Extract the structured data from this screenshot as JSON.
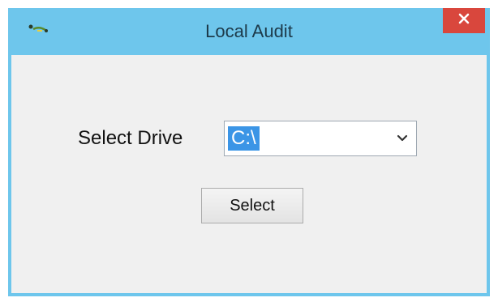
{
  "window": {
    "title": "Local Audit",
    "close_icon": "close-icon",
    "app_icon": "app-logo-icon"
  },
  "form": {
    "drive_label": "Select Drive",
    "drive_value": "C:\\",
    "dropdown_icon": "chevron-down-icon",
    "select_button_label": "Select"
  },
  "colors": {
    "titlebar": "#6ec6ec",
    "close_button": "#d9473d",
    "client_background": "#f0f0f0",
    "selection_highlight": "#3b95e6"
  }
}
